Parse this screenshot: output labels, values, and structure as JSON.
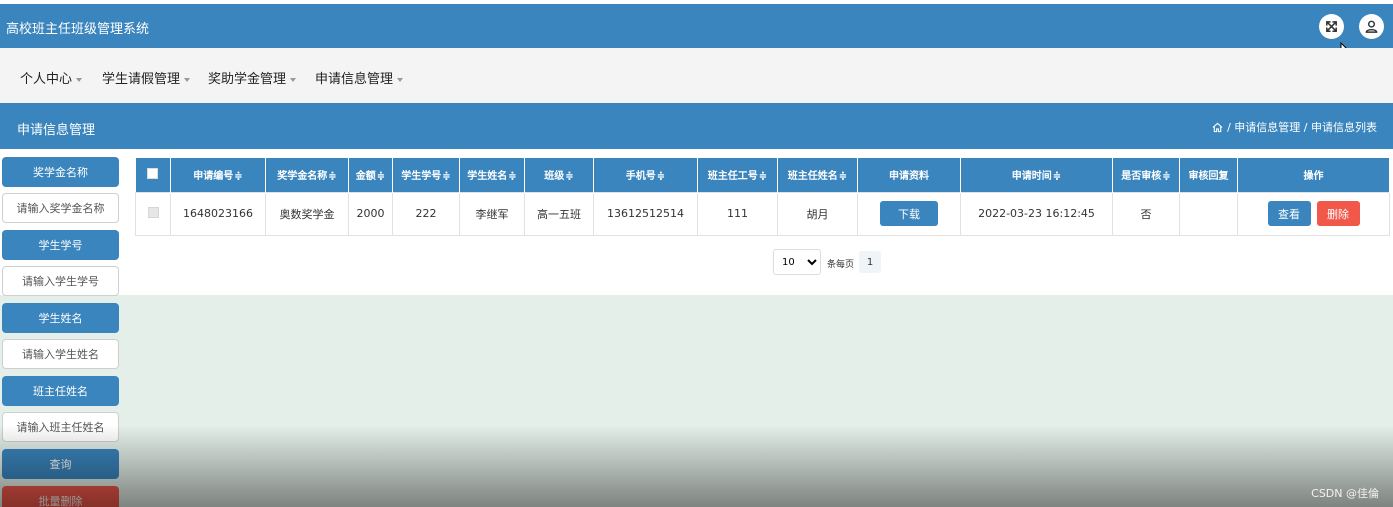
{
  "app": {
    "title": "高校班主任班级管理系统"
  },
  "header_icons": [
    "fullscreen-icon",
    "user-icon"
  ],
  "nav": [
    {
      "label": "个人中心"
    },
    {
      "label": "学生请假管理"
    },
    {
      "label": "奖助学金管理"
    },
    {
      "label": "申请信息管理"
    }
  ],
  "page": {
    "title": "申请信息管理",
    "breadcrumb": "/ 申请信息管理 / 申请信息列表"
  },
  "search": {
    "fields": [
      {
        "label": "奖学金名称",
        "placeholder": "请输入奖学金名称"
      },
      {
        "label": "学生学号",
        "placeholder": "请输入学生学号"
      },
      {
        "label": "学生姓名",
        "placeholder": "请输入学生姓名"
      },
      {
        "label": "班主任姓名",
        "placeholder": "请输入班主任姓名"
      }
    ],
    "query_label": "查询",
    "batch_delete_label": "批量删除"
  },
  "table": {
    "columns": [
      "申请编号",
      "奖学金名称",
      "金额",
      "学生学号",
      "学生姓名",
      "班级",
      "手机号",
      "班主任工号",
      "班主任姓名",
      "申请资料",
      "申请时间",
      "是否审核",
      "审核回复",
      "操作"
    ],
    "sort_mark": "≑",
    "rows": [
      {
        "apply_no": "1648023166",
        "scholarship": "奥数奖学金",
        "amount": "2000",
        "student_no": "222",
        "student_name": "李继军",
        "class": "高一五班",
        "phone": "13612512514",
        "teacher_no": "111",
        "teacher_name": "胡月",
        "download_label": "下载",
        "apply_time": "2022-03-23 16:12:45",
        "reviewed": "否",
        "reply": "",
        "view_label": "查看",
        "delete_label": "删除"
      }
    ]
  },
  "pagination": {
    "page_size": "10",
    "per_page_label": "条每页",
    "current_page": "1"
  },
  "watermark": "CSDN @佳倫",
  "colors": {
    "primary": "#3a85bd",
    "danger": "#f1584a",
    "content_bg": "#e4efe9"
  }
}
